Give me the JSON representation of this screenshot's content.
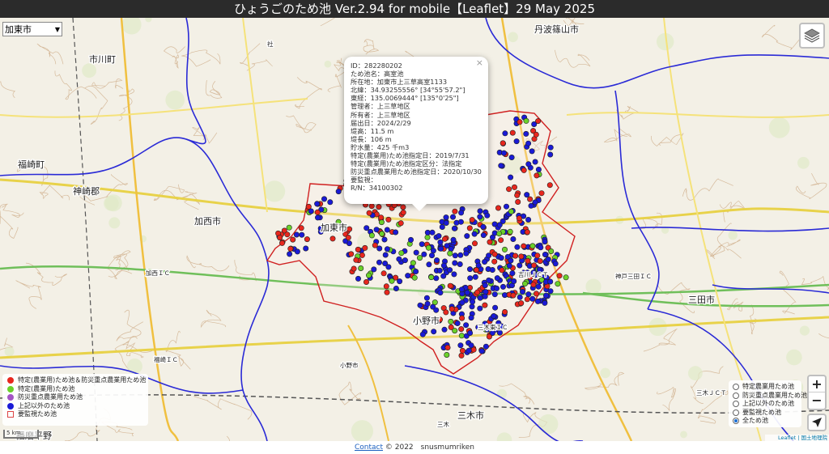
{
  "app": {
    "title": "ひょうごのため池 Ver.2.94 for mobile【Leaflet】29 May 2025"
  },
  "city_select": {
    "value": "加東市"
  },
  "popup": {
    "lines": [
      "ID：282280202",
      "ため池名：高室池",
      "所在地：加東市上三草高室1133",
      "北緯：34.93255556° [34°55'57.2\"]",
      "東経：135.0069444° [135°0'25\"]",
      "管理者：上三草地区",
      "所有者：上三草地区",
      "届出日：2024/2/29",
      "堤高：11.5 m",
      "堤長：106 m",
      "貯水量：425 千m3",
      "特定(農業用)ため池指定日：2019/7/31",
      "特定(農業用)ため池指定区分：法指定",
      "防災重点農業用ため池指定日：2020/10/30",
      "要監視：",
      "R/N：34100302"
    ],
    "close_label": "×"
  },
  "legend": {
    "items": [
      {
        "label": "特定(農業用)ため池＆防災重点農業用ため池",
        "color": "#e8271e"
      },
      {
        "label": "特定(農業用)ため池",
        "color": "#6bd12a"
      },
      {
        "label": "防災重点農業用ため池",
        "color": "#a454c4"
      },
      {
        "label": "上記以外のため池",
        "color": "#1a1ad6"
      }
    ],
    "watch_label": "要監視ため池"
  },
  "filter": {
    "options": [
      {
        "label": "特定農業用ため池",
        "selected": false
      },
      {
        "label": "防災重点農業用ため池",
        "selected": false
      },
      {
        "label": "上記以外のため池",
        "selected": false
      },
      {
        "label": "要監視ため池",
        "selected": false
      },
      {
        "label": "全ため池",
        "selected": true
      }
    ]
  },
  "zoom": {
    "in_label": "+",
    "out_label": "−"
  },
  "scale": {
    "label": "5 km"
  },
  "attribution": {
    "text": "Leaflet | 国土地理院"
  },
  "footer": {
    "contact_label": "Contact",
    "copyright": "© 2022　snusmumriken"
  },
  "map_labels": [
    "丹波篠山市",
    "市川町",
    "福崎町",
    "神崎郡",
    "加西市",
    "加東市",
    "小野市",
    "三木市",
    "三田市",
    "播磨平野",
    "神戸三田ＩＣ",
    "三木ＪＣＴ",
    "吉川ＪＣＴ",
    "三木東ＩＣ",
    "加西ＩＣ",
    "福崎ＩＣ",
    "小野市",
    "三木",
    "社"
  ],
  "colors": {
    "red": "#e8271e",
    "green": "#6bd12a",
    "blue": "#1a1ad6",
    "boundary": "#2a2ad6",
    "city_outline": "#d02020"
  }
}
